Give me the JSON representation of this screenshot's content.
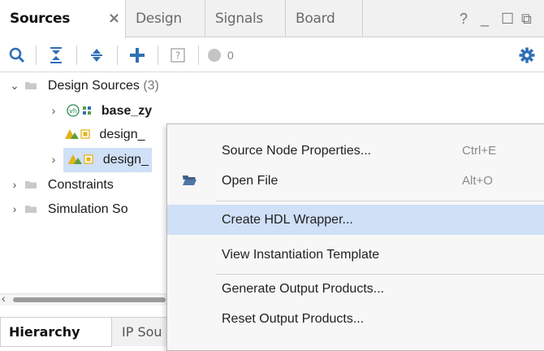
{
  "tabs": [
    {
      "label": "Sources",
      "active": true
    },
    {
      "label": "Design",
      "active": false
    },
    {
      "label": "Signals",
      "active": false
    },
    {
      "label": "Board",
      "active": false
    }
  ],
  "tab_close_glyph": "×",
  "window_controls": {
    "help": "?",
    "minimize": "_",
    "restore": "☐",
    "float": "⧉"
  },
  "toolbar": {
    "icons": [
      "search-icon",
      "collapse-all-icon",
      "expand-all-icon",
      "add-icon",
      "help-box-icon",
      "status-dot-icon",
      "gear-icon"
    ],
    "badge_count": "0"
  },
  "tree": {
    "design_sources": {
      "label": "Design Sources",
      "count": "(3)"
    },
    "items": [
      {
        "label": "base_zy",
        "bold": true,
        "chevron": "›",
        "vhdl_badge": "vh"
      },
      {
        "label": "design_",
        "bold": false,
        "chevron": ""
      },
      {
        "label": "design_",
        "bold": false,
        "chevron": "›",
        "selected": true
      }
    ],
    "constraints": "Constraints",
    "simulation": "Simulation So"
  },
  "bottom_tabs": [
    {
      "label": "Hierarchy",
      "active": true
    },
    {
      "label": "IP Sou",
      "active": false
    }
  ],
  "context_menu": {
    "items": [
      {
        "label": "Source Node Properties...",
        "shortcut": "Ctrl+E"
      },
      {
        "label": "Open File",
        "shortcut": "Alt+O"
      },
      {
        "label": "Create HDL Wrapper...",
        "shortcut": "",
        "highlighted": true
      },
      {
        "label": "View Instantiation Template",
        "shortcut": ""
      },
      {
        "label": "Generate Output Products...",
        "shortcut": ""
      },
      {
        "label": "Reset Output Products...",
        "shortcut": ""
      }
    ]
  },
  "colors": {
    "accent_blue": "#2f6fb5",
    "selection": "#cfe0f7",
    "folder_gray": "#c9c9c9",
    "bd_yellow": "#e3b21a",
    "bd_green": "#5aa03c"
  }
}
